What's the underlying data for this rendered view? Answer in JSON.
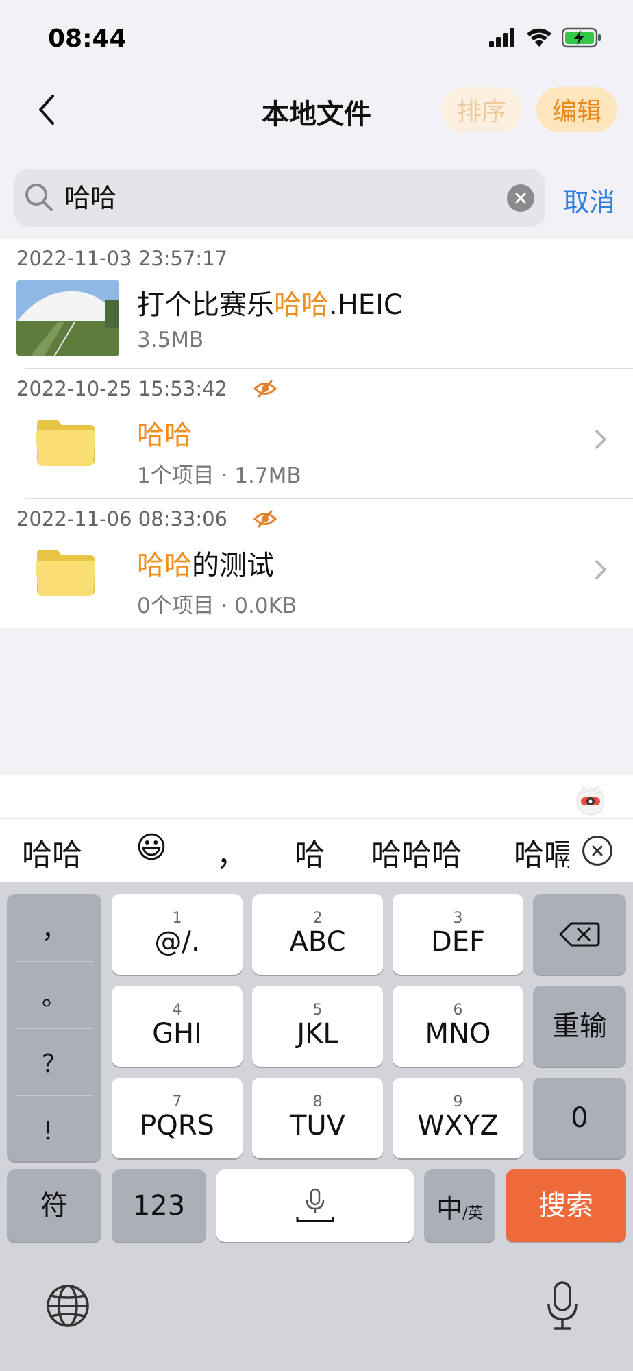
{
  "status_bar": {
    "time": "08:44"
  },
  "nav": {
    "title": "本地文件",
    "sort_label": "排序",
    "edit_label": "编辑"
  },
  "search": {
    "query": "哈哈",
    "cancel_label": "取消"
  },
  "results": [
    {
      "date": "2022-11-03 23:57:17",
      "hidden": false,
      "type": "image",
      "name_parts": [
        "打个比赛乐",
        "哈哈",
        ".HEIC"
      ],
      "meta": "3.5MB"
    },
    {
      "date": "2022-10-25 15:53:42",
      "hidden": true,
      "type": "folder",
      "name_parts": [
        "",
        "哈哈",
        ""
      ],
      "meta": "1个项目 · 1.7MB"
    },
    {
      "date": "2022-11-06 08:33:06",
      "hidden": true,
      "type": "folder",
      "name_parts": [
        "",
        "哈哈",
        "的测试"
      ],
      "meta": "0个项目 · 0.0KB"
    }
  ],
  "candidates": [
    "哈哈",
    "😃",
    "，",
    "哈",
    "哈哈哈",
    "哈嗝"
  ],
  "keyboard": {
    "punctuation": [
      "，",
      "。",
      "？",
      "！"
    ],
    "keys": [
      {
        "num": "1",
        "label": "@/."
      },
      {
        "num": "2",
        "label": "ABC"
      },
      {
        "num": "3",
        "label": "DEF"
      },
      {
        "num": "4",
        "label": "GHI"
      },
      {
        "num": "5",
        "label": "JKL"
      },
      {
        "num": "6",
        "label": "MNO"
      },
      {
        "num": "7",
        "label": "PQRS"
      },
      {
        "num": "8",
        "label": "TUV"
      },
      {
        "num": "9",
        "label": "WXYZ"
      }
    ],
    "reset_label": "重输",
    "zero_label": "0",
    "symbols_label": "符",
    "numbers_label": "123",
    "lang_main": "中",
    "lang_sub": "/英",
    "search_label": "搜索"
  },
  "colors": {
    "accent_orange": "#ef8d1e",
    "link_blue": "#2f7de1",
    "search_key": "#ef6a3b"
  }
}
